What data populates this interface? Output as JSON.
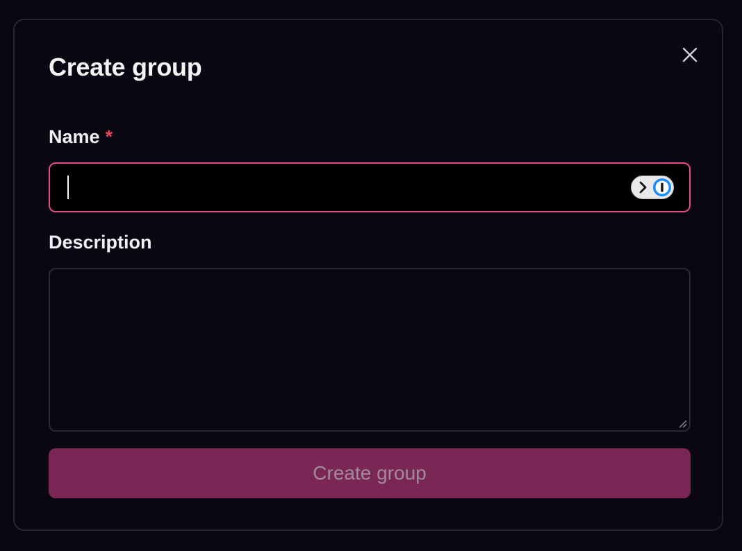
{
  "dialog": {
    "title": "Create group",
    "close_icon": "close-icon"
  },
  "form": {
    "name": {
      "label": "Name",
      "required_mark": "*",
      "value": "",
      "placeholder": "",
      "password_manager_icon": "password-manager-icon"
    },
    "description": {
      "label": "Description",
      "value": "",
      "placeholder": ""
    },
    "submit_label": "Create group"
  },
  "colors": {
    "background": "#0b0712",
    "border": "#2a2630",
    "focus_border": "#e44c8a",
    "required": "#ef4452",
    "button_bg": "#7b2756",
    "button_text": "#a28a99",
    "password_manager_accent": "#1a8cff"
  }
}
